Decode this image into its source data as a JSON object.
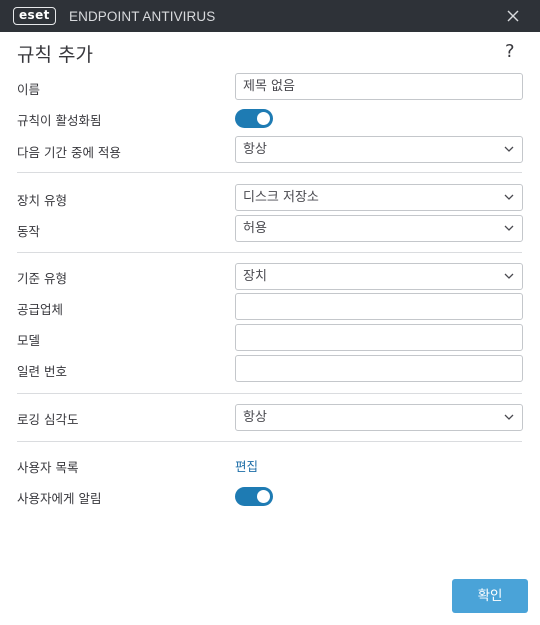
{
  "titlebar": {
    "logo_text": "eset",
    "product_name": "ENDPOINT ANTIVIRUS",
    "close_icon": "close-icon"
  },
  "dialog": {
    "title": "규칙 추가",
    "help": "?"
  },
  "form": {
    "name": {
      "label": "이름",
      "value": "제목 없음"
    },
    "rule_enabled": {
      "label": "규칙이 활성화됨",
      "state": "on"
    },
    "apply_during": {
      "label": "다음 기간 중에 적용",
      "value": "항상"
    },
    "device_type": {
      "label": "장치 유형",
      "value": "디스크 저장소"
    },
    "action": {
      "label": "동작",
      "value": "허용"
    },
    "criteria_type": {
      "label": "기준 유형",
      "value": "장치"
    },
    "vendor": {
      "label": "공급업체",
      "value": ""
    },
    "model": {
      "label": "모델",
      "value": ""
    },
    "serial": {
      "label": "일련 번호",
      "value": ""
    },
    "logging_severity": {
      "label": "로깅 심각도",
      "value": "항상"
    },
    "user_list": {
      "label": "사용자 목록",
      "link": "편집"
    },
    "notify_user": {
      "label": "사용자에게 알림",
      "state": "on"
    }
  },
  "footer": {
    "ok_label": "확인"
  },
  "colors": {
    "titlebar": "#2e3238",
    "toggle_on": "#1e7bb3",
    "link": "#1e6ea8",
    "primary_button": "#4aa3d8"
  }
}
